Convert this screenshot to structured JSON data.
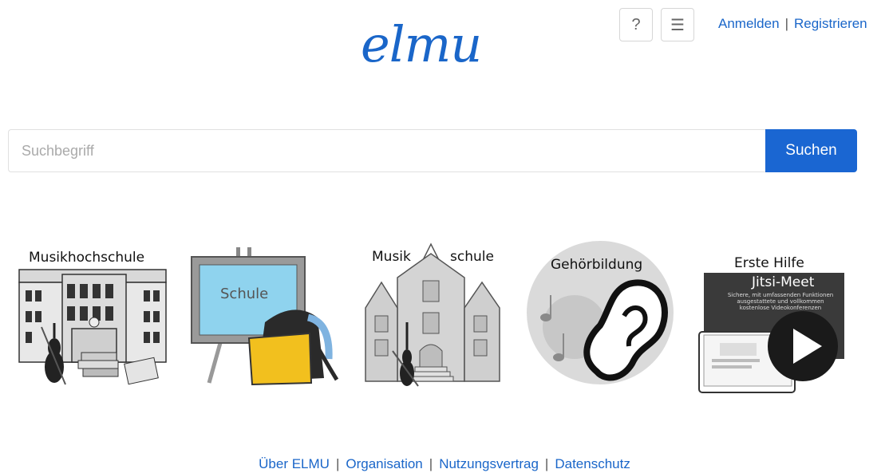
{
  "header": {
    "logo_text": "elmu",
    "help_icon": "question-mark-icon",
    "menu_icon": "hamburger-icon",
    "login_label": "Anmelden",
    "separator": "|",
    "register_label": "Registrieren"
  },
  "search": {
    "placeholder": "Suchbegriff",
    "button_label": "Suchen"
  },
  "tiles": [
    {
      "label": "Musikhochschule"
    },
    {
      "label": "Schule"
    },
    {
      "label_left": "Musik",
      "label_right": "schule"
    },
    {
      "label": "Gehörbildung"
    },
    {
      "label": "Erste Hilfe",
      "screen_title": "Jitsi-Meet",
      "screen_text": "Sichere, mit umfassenden Funktionen ausgestattete und vollkommen kostenlose Videokonferenzen"
    }
  ],
  "footer": {
    "links": [
      "Über ELMU",
      "Organisation",
      "Nutzungsvertrag",
      "Datenschutz"
    ],
    "separator": "|"
  },
  "colors": {
    "brand": "#1a66c9",
    "button": "#1a66d2"
  }
}
